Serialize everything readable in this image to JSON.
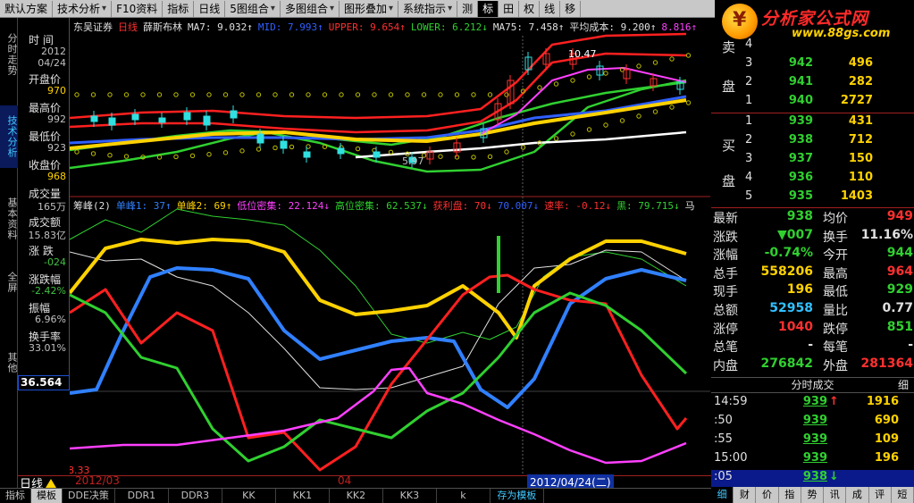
{
  "toolbar": {
    "buttons": [
      "默认方案",
      "技术分析",
      "F10资料",
      "指标",
      "日线",
      "5图组合",
      "多图组合",
      "图形叠加",
      "系统指示",
      "测",
      "标",
      "田",
      "权",
      "线",
      "移"
    ]
  },
  "logo": {
    "title": "分析家公式网",
    "url": "www.88gs.com"
  },
  "vtabs": [
    "分时走势",
    "技术分析",
    "基本资料",
    "全屏",
    "其他"
  ],
  "info": {
    "rows": [
      {
        "label": "时 间",
        "value": "2012",
        "color": "#c0c0c0"
      },
      {
        "label": "",
        "value": "04/24",
        "color": "#c0c0c0"
      },
      {
        "label": "开盘价",
        "value": "970",
        "color": "#ffd200"
      },
      {
        "label": "最高价",
        "value": "992",
        "color": "#c0c0c0"
      },
      {
        "label": "最低价",
        "value": "923",
        "color": "#c0c0c0"
      },
      {
        "label": "收盘价",
        "value": "968",
        "color": "#ffd200"
      },
      {
        "label": "成交量",
        "value": "165万",
        "color": "#c0c0c0"
      },
      {
        "label": "成交额",
        "value": "15.83亿",
        "color": "#c0c0c0"
      },
      {
        "label": "涨 跌",
        "value": "-024",
        "color": "#40c040"
      },
      {
        "label": "涨跌幅",
        "value": "-2.42%",
        "color": "#40c040"
      },
      {
        "label": "振幅",
        "value": "6.96%",
        "color": "#c0c0c0"
      },
      {
        "label": "换手率",
        "value": "33.01%",
        "color": "#c0c0c0"
      }
    ],
    "price_tag": "36.564"
  },
  "main_legend": [
    {
      "text": "东吴证券",
      "color": "#e0e0e0"
    },
    {
      "text": "日线",
      "color": "#ff3030"
    },
    {
      "text": "薛斯布林",
      "color": "#e0e0e0"
    },
    {
      "text": "MA7: 9.032↑",
      "color": "#e0e0e0"
    },
    {
      "text": "MID: 7.993↑",
      "color": "#3060ff"
    },
    {
      "text": "UPPER: 9.654↑",
      "color": "#ff3030"
    },
    {
      "text": "LOWER: 6.212↓",
      "color": "#30d030"
    },
    {
      "text": "MA75: 7.458↑",
      "color": "#e0e0e0"
    },
    {
      "text": "平均成本: 9.200↑",
      "color": "#e0e0e0"
    },
    {
      "text": "8.816↑",
      "color": "#ff40ff"
    }
  ],
  "sub_legend": [
    {
      "text": "筹峰(2)",
      "color": "#e0e0e0"
    },
    {
      "text": "单峰1: 37↑",
      "color": "#3080ff"
    },
    {
      "text": "单峰2: 69↑",
      "color": "#ffd200"
    },
    {
      "text": "低位密集: 22.124↓",
      "color": "#ff40ff"
    },
    {
      "text": "高位密集: 62.537↓",
      "color": "#30d030"
    },
    {
      "text": "获利盘: 70↓",
      "color": "#ff3030"
    },
    {
      "text": "70.007↓",
      "color": "#3060ff"
    },
    {
      "text": "速率: -0.12↓",
      "color": "#ff3030"
    },
    {
      "text": "黑: 79.715↓",
      "color": "#30d030"
    },
    {
      "text": "马",
      "color": "#e0e0e0"
    }
  ],
  "chart_labels": {
    "price_top": "10.47",
    "price_low": "5.97",
    "sub_bottom": "8.33"
  },
  "sell_book": [
    {
      "level": "4",
      "price": "",
      "vol": "",
      "color": "#30d030"
    },
    {
      "level": "3",
      "price": "942",
      "vol": "496",
      "color": "#30d030"
    },
    {
      "level": "2",
      "price": "941",
      "vol": "282",
      "color": "#30d030"
    },
    {
      "level": "1",
      "price": "940",
      "vol": "2727",
      "color": "#30d030"
    }
  ],
  "buy_book": [
    {
      "level": "1",
      "price": "939",
      "vol": "431",
      "color": "#30d030"
    },
    {
      "level": "2",
      "price": "938",
      "vol": "712",
      "color": "#30d030"
    },
    {
      "level": "3",
      "price": "937",
      "vol": "150",
      "color": "#30d030"
    },
    {
      "level": "4",
      "price": "936",
      "vol": "110",
      "color": "#30d030"
    },
    {
      "level": "5",
      "price": "935",
      "vol": "1403",
      "color": "#30d030"
    }
  ],
  "side_labels": {
    "sell": [
      "卖",
      "盘"
    ],
    "buy": [
      "买",
      "盘"
    ]
  },
  "quote": [
    {
      "l1": "最新",
      "v1": "938",
      "c1": "#30d030",
      "l2": "均价",
      "v2": "949",
      "c2": "#ff3030"
    },
    {
      "l1": "涨跌",
      "v1": "▼007",
      "c1": "#30d030",
      "l2": "换手",
      "v2": "11.16%",
      "c2": "#e0e0e0"
    },
    {
      "l1": "涨幅",
      "v1": "-0.74%",
      "c1": "#30d030",
      "l2": "今开",
      "v2": "944",
      "c2": "#30d030"
    },
    {
      "l1": "总手",
      "v1": "558206",
      "c1": "#ffd200",
      "l2": "最高",
      "v2": "964",
      "c2": "#ff3030"
    },
    {
      "l1": "现手",
      "v1": "196",
      "c1": "#ffd200",
      "l2": "最低",
      "v2": "929",
      "c2": "#30d030"
    },
    {
      "l1": "总额",
      "v1": "52958",
      "c1": "#30c0ff",
      "l2": "量比",
      "v2": "0.77",
      "c2": "#e0e0e0"
    },
    {
      "l1": "涨停",
      "v1": "1040",
      "c1": "#ff3030",
      "l2": "跌停",
      "v2": "851",
      "c2": "#30d030"
    },
    {
      "l1": "总笔",
      "v1": "-",
      "c1": "#e0e0e0",
      "l2": "每笔",
      "v2": "-",
      "c2": "#e0e0e0"
    },
    {
      "l1": "内盘",
      "v1": "276842",
      "c1": "#30d030",
      "l2": "外盘",
      "v2": "281364",
      "c2": "#ff3030"
    }
  ],
  "ticks": {
    "title": "分时成交",
    "close": "细",
    "rows": [
      {
        "time": "14:59",
        "price": "939",
        "arrow": "↑",
        "arrow_color": "#ff3030",
        "vol": "1916"
      },
      {
        "time": ":50",
        "price": "939",
        "arrow": "",
        "arrow_color": "#ff3030",
        "vol": "690"
      },
      {
        "time": ":55",
        "price": "939",
        "arrow": "",
        "arrow_color": "#ff3030",
        "vol": "109"
      },
      {
        "time": "15:00",
        "price": "939",
        "arrow": "",
        "arrow_color": "#ff3030",
        "vol": "196"
      },
      {
        "time": ":05",
        "price": "938",
        "arrow": "↓",
        "arrow_color": "#30d030",
        "vol": ""
      }
    ]
  },
  "right_tabs": [
    "细",
    "财",
    "价",
    "指",
    "势",
    "讯",
    "成",
    "评",
    "短"
  ],
  "period": {
    "label": "日线",
    "d1": "2012/03",
    "d2": "04",
    "d3": "2012/04/24(二)"
  },
  "bottom_tabs": [
    "指标",
    "模板",
    "DDE决策",
    "DDR1",
    "DDR3",
    "KK",
    "KK1",
    "KK2",
    "KK3",
    "k",
    "存为模板"
  ]
}
